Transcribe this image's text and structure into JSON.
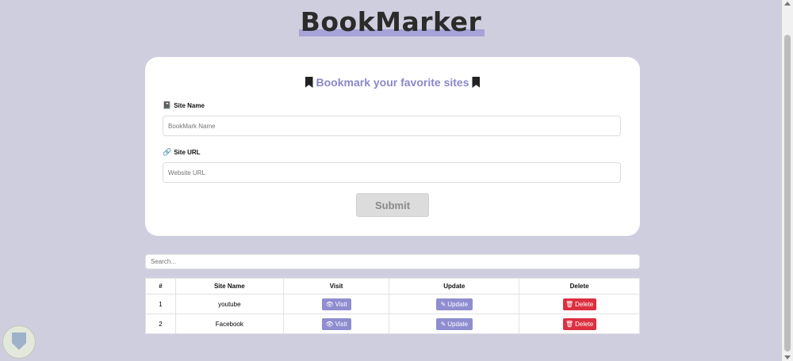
{
  "app": {
    "title": "BookMarker"
  },
  "form": {
    "heading": "Bookmark your favorite sites",
    "site_name_label": "Site Name",
    "site_name_placeholder": "BookMark Name",
    "site_url_label": "Site URL",
    "site_url_placeholder": "Website URL",
    "submit_label": "Submit"
  },
  "search": {
    "placeholder": "Search..."
  },
  "table": {
    "headers": [
      "#",
      "Site Name",
      "Visit",
      "Update",
      "Delete"
    ],
    "rows": [
      {
        "index": "1",
        "name": "youtube",
        "visit": "Visit",
        "update": "Update",
        "delete": "Delete"
      },
      {
        "index": "2",
        "name": "Facebook",
        "visit": "Visit",
        "update": "Update",
        "delete": "Delete"
      }
    ]
  },
  "colors": {
    "accent": "#8f8dd0",
    "danger": "#dc2f3f",
    "background": "#cfcedf"
  },
  "icons": {
    "heading": "bookmark-icon",
    "site_name": "book-icon",
    "site_url": "link-icon",
    "visit": "eye-icon",
    "update": "edit-icon",
    "delete": "trash-icon"
  }
}
